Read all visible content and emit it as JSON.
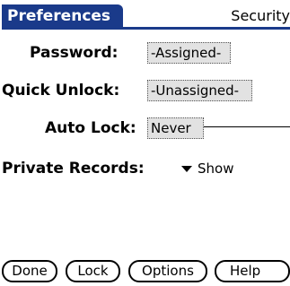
{
  "header": {
    "title": "Preferences",
    "category": "Security"
  },
  "fields": {
    "password": {
      "label": "Password:",
      "value": "-Assigned-"
    },
    "quick_unlock": {
      "label": "Quick Unlock:",
      "value": "-Unassigned-"
    },
    "auto_lock": {
      "label": "Auto Lock:",
      "value": "Never"
    },
    "private_records": {
      "label": "Private Records:",
      "value": "Show"
    }
  },
  "buttons": {
    "done": "Done",
    "lock": "Lock",
    "options": "Options",
    "help": "Help"
  },
  "colors": {
    "title_bar": "#1a3a8a",
    "selector_bg": "#e2e2e2"
  }
}
